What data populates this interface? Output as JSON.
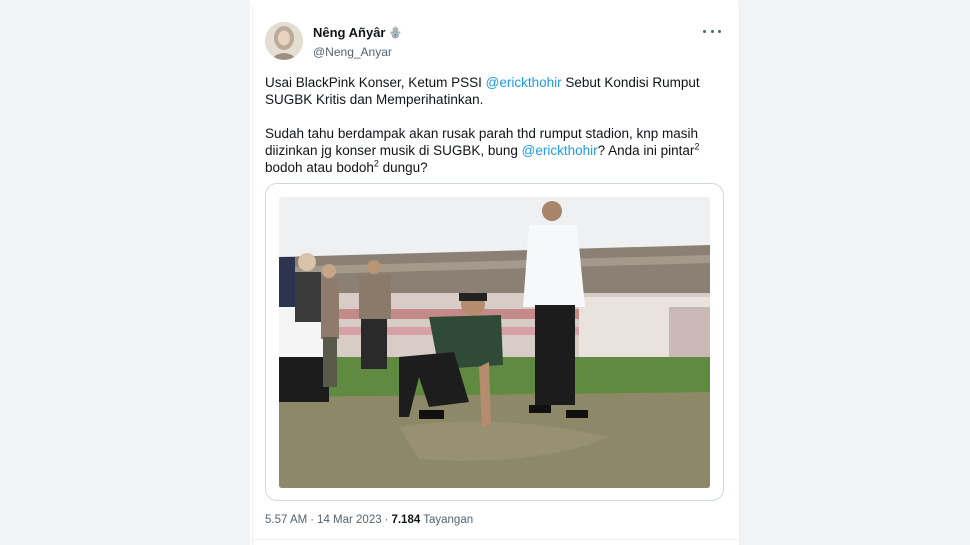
{
  "tweet": {
    "author": {
      "display_name": "Nêng Añyâr",
      "name_emoji": "🪬",
      "handle": "@Neng_Anyar"
    },
    "paragraph1": {
      "before": "Usai BlackPink Konser, Ketum PSSI ",
      "mention": "@erickthohir",
      "after": " Sebut Kondisi Rumput SUGBK Kritis dan Memperihatinkan."
    },
    "paragraph2": {
      "before": "Sudah tahu berdampak akan rusak parah thd rumput stadion, knp masih diizinkan jg konser musik di SUGBK, bung ",
      "mention": "@erickthohir",
      "middle": "? Anda ini pintar",
      "sup1": "2",
      "after": " bodoh atau bodoh",
      "sup2": "2",
      "end": " dungu?"
    },
    "meta": {
      "time": "5.57 AM",
      "separator": "·",
      "date": "14 Mar 2023",
      "views": "7.184",
      "views_label": "Tayangan"
    }
  },
  "colors": {
    "text": "#0f1419",
    "secondary": "#536471",
    "link": "#1d9bf0",
    "border": "#cfd9de"
  },
  "icons": {
    "more": "more-horizontal-icon"
  }
}
